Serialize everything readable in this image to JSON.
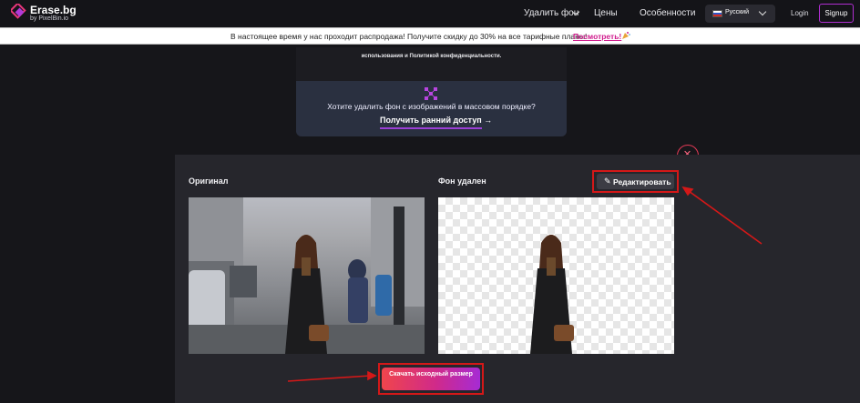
{
  "header": {
    "logo_name": "Erase.bg",
    "logo_by": "by PixelBin.io",
    "nav": {
      "remove_bg": "Удалить фон",
      "prices": "Цены",
      "features": "Особенности"
    },
    "language": "Русский",
    "login": "Login",
    "signup": "Signup"
  },
  "banner": {
    "text": "В настоящее время у нас проходит распродажа! Получите скидку до 30% на все тарифные планы!",
    "link": "Посмотреть!"
  },
  "card": {
    "terms_text": "использования и Политикой конфиденциальности.",
    "bulk_question": "Хотите удалить фон с изображений в массовом порядке?",
    "early_access": "Получить ранний доступ →"
  },
  "result": {
    "original_label": "Оригинал",
    "removed_label": "Фон удален",
    "edit_button": "Редактировать",
    "download_button": "Скачать исходный размер"
  },
  "colors": {
    "accent_purple": "#a62bd4",
    "accent_red": "#f0454c",
    "highlight_red": "#d41818",
    "banner_link": "#d01b8d"
  },
  "icons": {
    "logo": "erasebg-logo-icon",
    "nav_chevron": "chevron-down-icon",
    "flag": "russia-flag-icon",
    "party": "party-popper-icon",
    "bulk": "bulk-images-icon",
    "close": "close-icon",
    "edit": "pencil-icon"
  }
}
